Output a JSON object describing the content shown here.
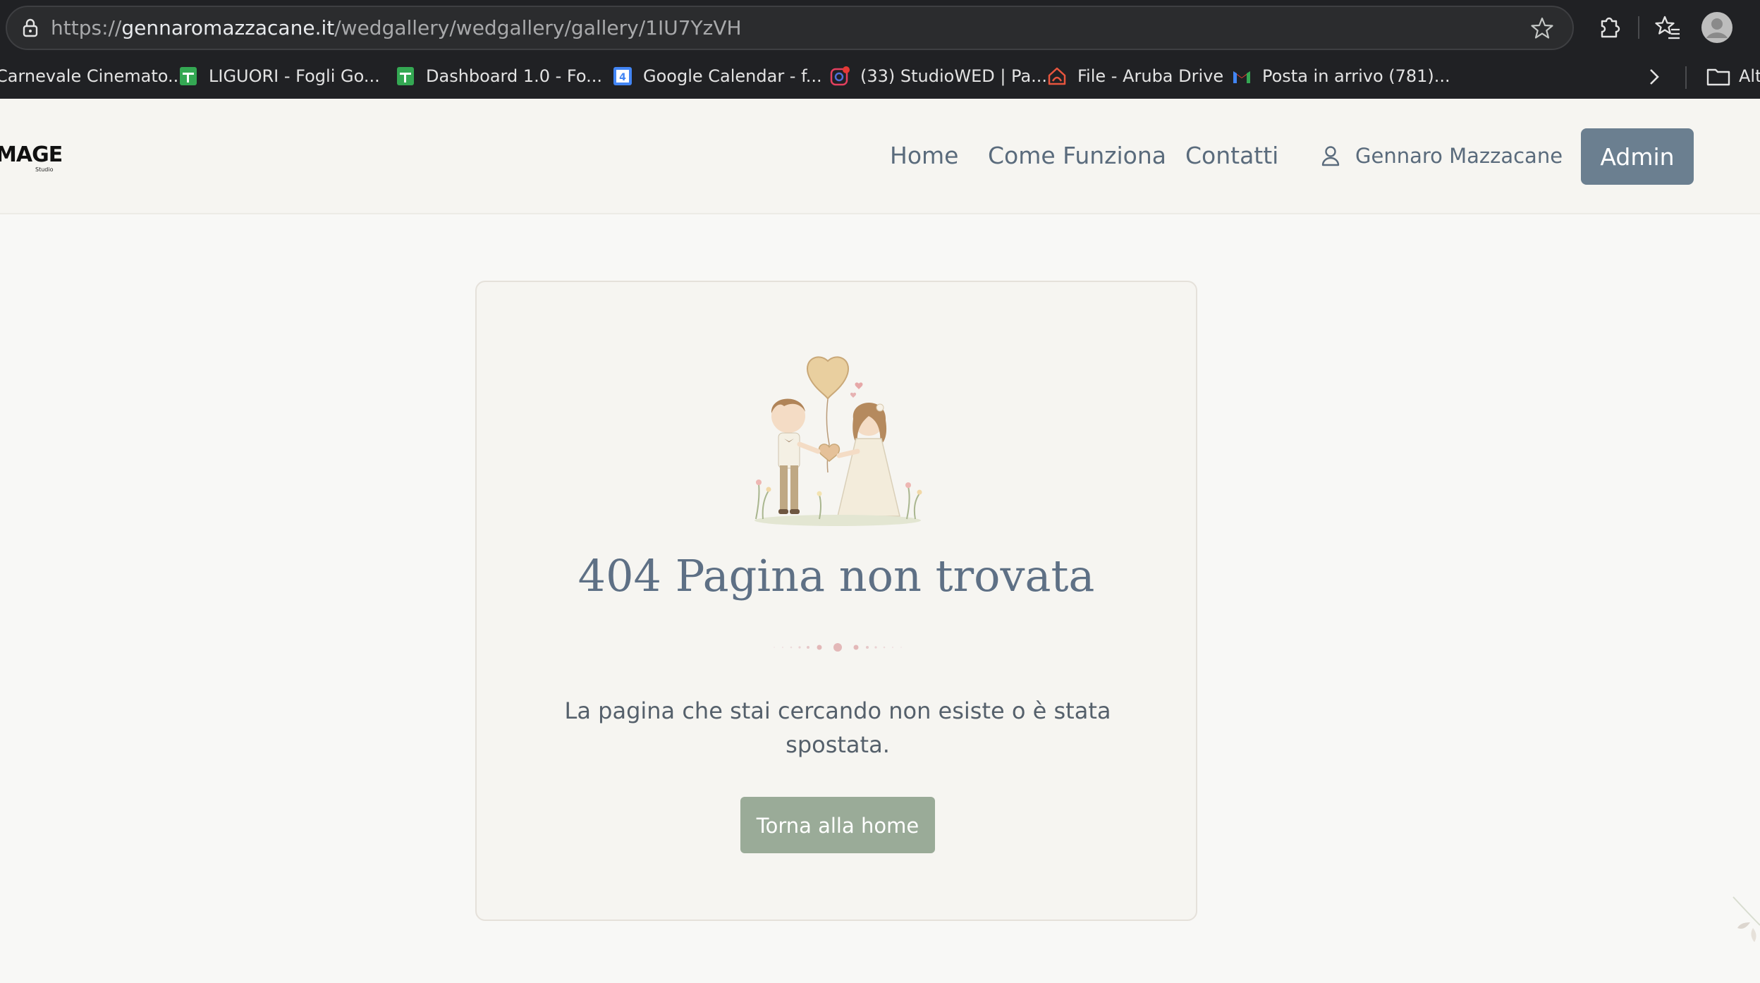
{
  "browser": {
    "url_scheme": "https://",
    "url_host": "gennaromazzacane.it",
    "url_path": "/wedgallery/wedgallery/gallery/1IU7YzVH",
    "bookmarks": [
      {
        "label": "Carnevale Cinemato...",
        "icon": "bookmark-icon"
      },
      {
        "label": "LIGUORI - Fogli Go...",
        "icon": "google-sheets-icon"
      },
      {
        "label": "Dashboard 1.0 - Fo...",
        "icon": "google-sheets-icon"
      },
      {
        "label": "Google Calendar - f...",
        "icon": "google-calendar-icon"
      },
      {
        "label": "(33) StudioWED | Pa...",
        "icon": "instagram-icon"
      },
      {
        "label": "File - Aruba Drive",
        "icon": "aruba-drive-icon"
      },
      {
        "label": "Posta in arrivo (781)...",
        "icon": "gmail-icon"
      }
    ],
    "bookmarks_folder": "Alt"
  },
  "header": {
    "logo": "MAGE",
    "logo_sub": "Studio",
    "nav": [
      "Home",
      "Come Funziona",
      "Contatti"
    ],
    "user_name": "Gennaro Mazzacane",
    "admin_label": "Admin"
  },
  "error": {
    "title": "404 Pagina non trovata",
    "message": "La pagina che stai cercando non esiste o è stata spostata.",
    "button": "Torna alla home"
  },
  "colors": {
    "accent": "#6b7f90",
    "button_green": "#9aab98",
    "title": "#5e7085",
    "background": "#f8f8f6"
  }
}
